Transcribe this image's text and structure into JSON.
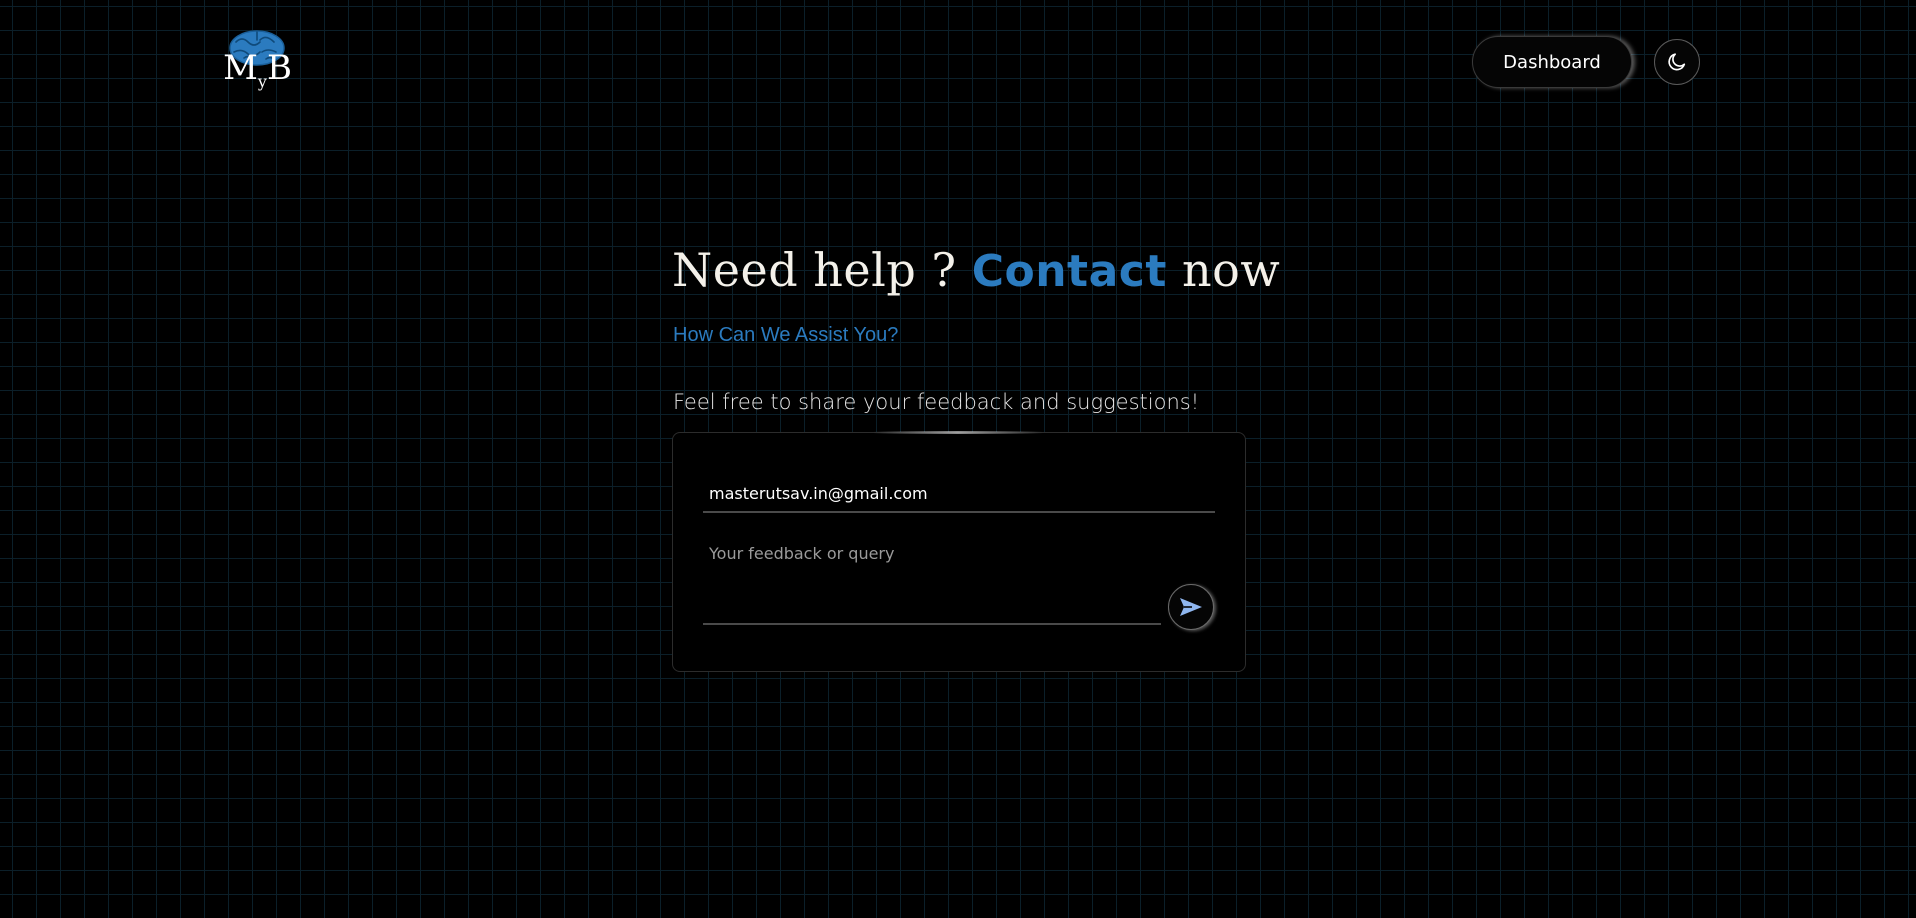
{
  "header": {
    "logo": {
      "text_main": "M",
      "text_sub": "y",
      "text_end": "B",
      "icon": "brain-icon",
      "icon_color": "#2b7bbf"
    },
    "dashboard_label": "Dashboard",
    "theme_toggle_icon": "moon-icon"
  },
  "hero": {
    "heading_part1": "Need help ? ",
    "heading_accent": "Contact",
    "heading_part2": " now",
    "subheading": "How Can We Assist You?",
    "intro": "Feel free to share your feedback and suggestions!"
  },
  "form": {
    "email_value": "masterutsav.in@gmail.com",
    "email_placeholder": "",
    "feedback_value": "",
    "feedback_placeholder": "Your feedback or query",
    "send_icon": "send-icon"
  },
  "colors": {
    "background": "#000000",
    "accent": "#2b7bbf",
    "send_icon_color": "#8fb6ef"
  }
}
